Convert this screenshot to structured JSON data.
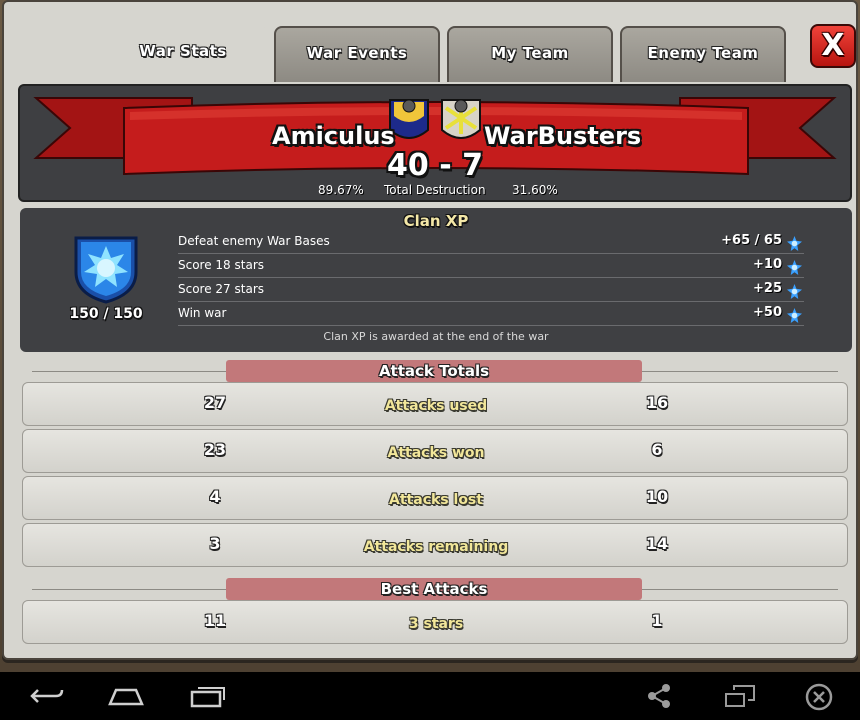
{
  "tabs": [
    {
      "label": "War Stats",
      "active": true
    },
    {
      "label": "War Events",
      "active": false
    },
    {
      "label": "My Team",
      "active": false
    },
    {
      "label": "Enemy Team",
      "active": false
    }
  ],
  "close_label": "X",
  "header": {
    "left_clan": "Amiculus",
    "right_clan": "WarBusters",
    "left_badge_level": "4",
    "right_badge_level": "1",
    "score": "40 - 7",
    "left_destruction": "89.67%",
    "destruction_label": "Total Destruction",
    "right_destruction": "31.60%"
  },
  "clan_xp": {
    "title": "Clan XP",
    "count": "150 / 150",
    "rows": [
      {
        "label": "Defeat enemy War Bases",
        "value": "+65 / 65"
      },
      {
        "label": "Score 18 stars",
        "value": "+10"
      },
      {
        "label": "Score 27 stars",
        "value": "+25"
      },
      {
        "label": "Win war",
        "value": "+50"
      }
    ],
    "note": "Clan XP is awarded at the end of the war"
  },
  "attack_totals": {
    "title": "Attack Totals",
    "rows": [
      {
        "left": "27",
        "label": "Attacks used",
        "right": "16"
      },
      {
        "left": "23",
        "label": "Attacks won",
        "right": "6"
      },
      {
        "left": "4",
        "label": "Attacks lost",
        "right": "10"
      },
      {
        "left": "3",
        "label": "Attacks remaining",
        "right": "14"
      }
    ]
  },
  "best_attacks": {
    "title": "Best Attacks",
    "rows": [
      {
        "left": "11",
        "label": "3 stars",
        "right": "1"
      }
    ]
  },
  "navbar": {
    "icons": [
      "back-icon",
      "home-icon",
      "recent-apps-icon",
      "share-icon",
      "screen-mirror-icon",
      "close-circle-icon"
    ]
  },
  "colors": {
    "ribbon_red": "#c01a1a",
    "xp_blue": "#1f7fe0",
    "section_pill": "#c2787a",
    "label_yellow": "#f2e79a"
  }
}
